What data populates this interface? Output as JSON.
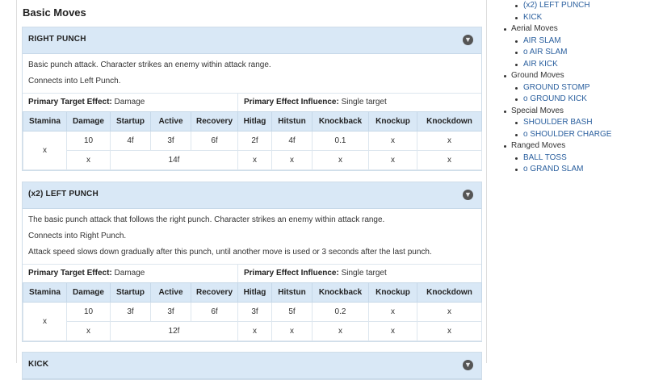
{
  "main": {
    "section_title": "Basic Moves",
    "collapse_glyph": "▼",
    "moves": [
      {
        "title": "RIGHT PUNCH",
        "description": [
          "Basic punch attack. Character strikes an enemy within attack range.",
          "Connects into Left Punch."
        ],
        "primary_target_label": "Primary Target Effect:",
        "primary_target_value": "Damage",
        "primary_influence_label": "Primary Effect Influence:",
        "primary_influence_value": "Single target",
        "stats_headers": [
          "Stamina",
          "Damage",
          "Startup",
          "Active",
          "Recovery",
          "Hitlag",
          "Hitstun",
          "Knockback",
          "Knockup",
          "Knockdown"
        ],
        "stats_row1": [
          "x",
          "10",
          "4f",
          "3f",
          "6f",
          "2f",
          "4f",
          "0.1",
          "x",
          "x"
        ],
        "stats_row2": {
          "damage": "x",
          "frames": "14f",
          "hitlag": "x",
          "hitstun": "x",
          "knockback": "x",
          "knockup": "x",
          "knockdown": "x"
        }
      },
      {
        "title": "(x2) LEFT PUNCH",
        "description": [
          "The basic punch attack that follows the right punch. Character strikes an enemy within attack range.",
          "Connects into Right Punch.",
          "Attack speed slows down gradually after this punch, until another move is used or 3 seconds after the last punch."
        ],
        "primary_target_label": "Primary Target Effect:",
        "primary_target_value": "Damage",
        "primary_influence_label": "Primary Effect Influence:",
        "primary_influence_value": "Single target",
        "stats_headers": [
          "Stamina",
          "Damage",
          "Startup",
          "Active",
          "Recovery",
          "Hitlag",
          "Hitstun",
          "Knockback",
          "Knockup",
          "Knockdown"
        ],
        "stats_row1": [
          "x",
          "10",
          "3f",
          "3f",
          "6f",
          "3f",
          "5f",
          "0.2",
          "x",
          "x"
        ],
        "stats_row2": {
          "damage": "x",
          "frames": "12f",
          "hitlag": "x",
          "hitstun": "x",
          "knockback": "x",
          "knockup": "x",
          "knockdown": "x"
        }
      },
      {
        "title": "KICK"
      }
    ]
  },
  "sidebar": {
    "items": [
      {
        "label": "(x2) LEFT PUNCH",
        "level": "sub"
      },
      {
        "label": "KICK",
        "level": "sub"
      },
      {
        "label": "Aerial Moves",
        "level": "cat"
      },
      {
        "label": "AIR SLAM",
        "level": "sub"
      },
      {
        "label": "o AIR SLAM",
        "level": "sub"
      },
      {
        "label": "AIR KICK",
        "level": "sub"
      },
      {
        "label": "Ground Moves",
        "level": "cat"
      },
      {
        "label": "GROUND STOMP",
        "level": "sub"
      },
      {
        "label": "o GROUND KICK",
        "level": "sub"
      },
      {
        "label": "Special Moves",
        "level": "cat"
      },
      {
        "label": "SHOULDER BASH",
        "level": "sub"
      },
      {
        "label": "o SHOULDER CHARGE",
        "level": "sub"
      },
      {
        "label": "Ranged Moves",
        "level": "cat"
      },
      {
        "label": "BALL TOSS",
        "level": "sub"
      },
      {
        "label": "o GRAND SLAM",
        "level": "sub"
      }
    ]
  }
}
